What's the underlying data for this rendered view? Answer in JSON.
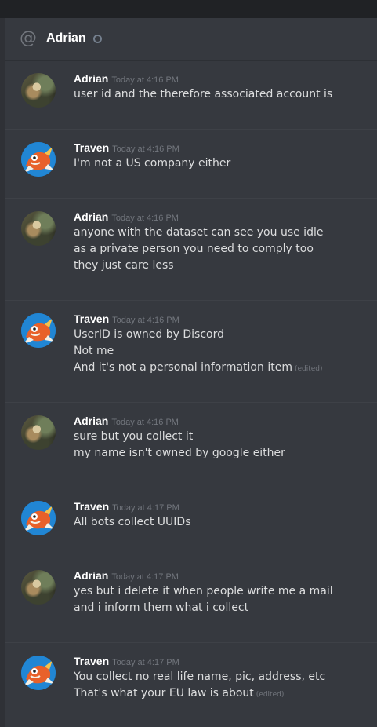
{
  "header": {
    "title": "Adrian",
    "at_icon": "at-icon",
    "status": "offline"
  },
  "messages": [
    {
      "author": "Adrian",
      "avatar": "adrian-avatar",
      "timestamp": "Today at 4:16 PM",
      "lines": [
        {
          "text": "user id and the therefore associated account is"
        }
      ]
    },
    {
      "author": "Traven",
      "avatar": "traven-avatar",
      "timestamp": "Today at 4:16 PM",
      "lines": [
        {
          "text": "I'm not a US company either"
        }
      ]
    },
    {
      "author": "Adrian",
      "avatar": "adrian-avatar",
      "timestamp": "Today at 4:16 PM",
      "lines": [
        {
          "text": "anyone with the dataset can see you use idle"
        },
        {
          "text": "as a private person you need to comply too"
        },
        {
          "text": "they just care less"
        }
      ]
    },
    {
      "author": "Traven",
      "avatar": "traven-avatar",
      "timestamp": "Today at 4:16 PM",
      "lines": [
        {
          "text": "UserID is owned by Discord"
        },
        {
          "text": "Not me"
        },
        {
          "text": "And it's not a personal information item",
          "edited": "(edited)"
        }
      ]
    },
    {
      "author": "Adrian",
      "avatar": "adrian-avatar",
      "timestamp": "Today at 4:16 PM",
      "lines": [
        {
          "text": "sure but you collect it"
        },
        {
          "text": "my name isn't owned by google either"
        }
      ]
    },
    {
      "author": "Traven",
      "avatar": "traven-avatar",
      "timestamp": "Today at 4:17 PM",
      "lines": [
        {
          "text": "All bots collect UUIDs"
        }
      ]
    },
    {
      "author": "Adrian",
      "avatar": "adrian-avatar",
      "timestamp": "Today at 4:17 PM",
      "lines": [
        {
          "text": "yes but i delete it when people write me a mail"
        },
        {
          "text": "and i inform them what i collect"
        }
      ]
    },
    {
      "author": "Traven",
      "avatar": "traven-avatar",
      "timestamp": "Today at 4:17 PM",
      "lines": [
        {
          "text": "You collect no real life name, pic, address, etc"
        },
        {
          "text": "That's what your EU law is about",
          "edited": "(edited)"
        }
      ]
    }
  ]
}
